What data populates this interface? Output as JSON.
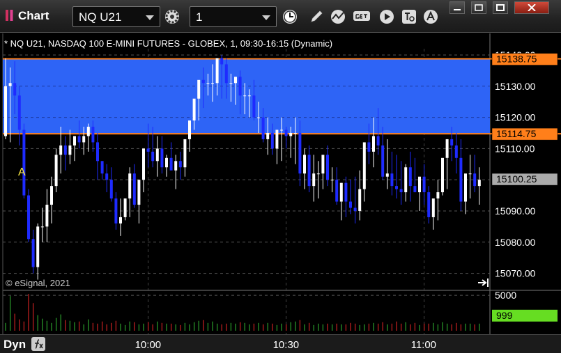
{
  "window": {
    "title": "Chart",
    "symbol": "NQ U21",
    "interval": "1"
  },
  "info": {
    "description": "* NQ U21, NASDAQ 100 E-MINI FUTURES - GLOBEX, 1, 09:30-16:15 (Dynamic)",
    "copyright": "© eSignal, 2021",
    "marker": "A"
  },
  "bottom": {
    "mode": "Dyn"
  },
  "colors": {
    "background": "#000000",
    "zone_fill": "#2e64f6",
    "zone_line": "#ff7f1a",
    "up_bar": "#ffffff",
    "down_bar": "#1e2bff",
    "vol_up": "#2ca02c",
    "vol_down": "#cc2222",
    "current_price_bg": "#aaaaaa",
    "volume_current_bg": "#66dd22"
  },
  "chart_data": {
    "type": "candlestick",
    "price_axis": {
      "ylim": [
        15065,
        15142
      ],
      "ticks": [
        "15140.00",
        "15130.00",
        "15120.00",
        "15110.00",
        "15090.00",
        "15080.00",
        "15070.00"
      ]
    },
    "zone": {
      "top": 15138.75,
      "bottom": 15114.75
    },
    "price_labels": {
      "zone_top": "15138.75",
      "zone_bottom": "15114.75",
      "current": "15100.25"
    },
    "volume_axis": {
      "ylim": [
        0,
        5400
      ],
      "tick": "5000",
      "current": "999"
    },
    "x_ticks": [
      {
        "label": "10:00",
        "index": 31
      },
      {
        "label": "10:30",
        "index": 61
      },
      {
        "label": "11:00",
        "index": 91
      }
    ],
    "bars": {
      "open": [
        15114,
        15130,
        15131,
        15127,
        15116,
        15095,
        15081,
        15072,
        15085,
        15085,
        15092,
        15098,
        15108,
        15111,
        15108,
        15111,
        15114,
        15112,
        15114,
        15117,
        15112,
        15106,
        15102,
        15100,
        15094,
        15086,
        15088,
        15094,
        15102,
        15092,
        15100,
        15110,
        15109,
        15106,
        15110,
        15104,
        15107,
        15103,
        15106,
        15104,
        15113,
        15119,
        15126,
        15132,
        15131,
        15131,
        15131,
        15139,
        15137,
        15131,
        15131,
        15133,
        15127,
        15127,
        15127,
        15120,
        15120,
        15113,
        15115,
        15110,
        15116,
        15116,
        15114,
        15115,
        15115,
        15102,
        15108,
        15098,
        15102,
        15102,
        15108,
        15100,
        15100,
        15093,
        15099,
        15093,
        15091,
        15090,
        15097,
        15112,
        15109,
        15114,
        15111,
        15101,
        15102,
        15098,
        15097,
        15096,
        15104,
        15098,
        15096,
        15101,
        15096,
        15088,
        15094,
        15096,
        15107,
        15113,
        15111,
        15107,
        15093,
        15102,
        15102,
        15098
      ],
      "high": [
        15139,
        15136,
        15138,
        15130,
        15118,
        15097,
        15084,
        15086,
        15091,
        15097,
        15101,
        15110,
        15117,
        15114,
        15116,
        15114,
        15119,
        15117,
        15118,
        15119,
        15115,
        15106,
        15105,
        15104,
        15096,
        15094,
        15094,
        15104,
        15105,
        15096,
        15110,
        15118,
        15117,
        15114,
        15114,
        15108,
        15112,
        15108,
        15109,
        15110,
        15115,
        15123,
        15131,
        15136,
        15134,
        15137,
        15137,
        15140,
        15139,
        15134,
        15133,
        15135,
        15131,
        15129,
        15132,
        15125,
        15123,
        15120,
        15118,
        15114,
        15120,
        15117,
        15117,
        15120,
        15119,
        15110,
        15111,
        15108,
        15106,
        15107,
        15111,
        15104,
        15104,
        15099,
        15101,
        15100,
        15101,
        15103,
        15108,
        15118,
        15120,
        15123,
        15117,
        15113,
        15109,
        15108,
        15106,
        15105,
        15109,
        15107,
        15100,
        15105,
        15098,
        15092,
        15100,
        15102,
        15108,
        15117,
        15115,
        15113,
        15101,
        15108,
        15108,
        15104
      ],
      "low": [
        15113,
        15112,
        15121,
        15111,
        15094,
        15080,
        15070,
        15068,
        15080,
        15080,
        15086,
        15096,
        15102,
        15103,
        15105,
        15106,
        15110,
        15108,
        15109,
        15109,
        15100,
        15100,
        15096,
        15093,
        15084,
        15082,
        15087,
        15088,
        15091,
        15086,
        15096,
        15104,
        15104,
        15101,
        15102,
        15101,
        15104,
        15097,
        15100,
        15101,
        15109,
        15116,
        15119,
        15123,
        15127,
        15125,
        15127,
        15126,
        15126,
        15125,
        15124,
        15121,
        15121,
        15120,
        15119,
        15115,
        15112,
        15108,
        15108,
        15105,
        15106,
        15110,
        15107,
        15105,
        15098,
        15097,
        15096,
        15093,
        15094,
        15097,
        15098,
        15096,
        15092,
        15087,
        15088,
        15089,
        15086,
        15087,
        15093,
        15105,
        15104,
        15108,
        15100,
        15097,
        15095,
        15094,
        15092,
        15093,
        15093,
        15096,
        15090,
        15092,
        15086,
        15084,
        15087,
        15095,
        15097,
        15106,
        15102,
        15090,
        15089,
        15094,
        15096,
        15092
      ],
      "close": [
        15130,
        15131,
        15127,
        15116,
        15095,
        15081,
        15072,
        15085,
        15085,
        15092,
        15098,
        15108,
        15111,
        15108,
        15111,
        15114,
        15112,
        15114,
        15117,
        15112,
        15106,
        15102,
        15100,
        15094,
        15086,
        15088,
        15094,
        15102,
        15092,
        15100,
        15110,
        15109,
        15106,
        15110,
        15104,
        15107,
        15103,
        15106,
        15104,
        15113,
        15119,
        15126,
        15132,
        15131,
        15131,
        15131,
        15139,
        15137,
        15131,
        15131,
        15133,
        15127,
        15127,
        15127,
        15120,
        15120,
        15113,
        15115,
        15110,
        15116,
        15116,
        15114,
        15115,
        15115,
        15102,
        15108,
        15098,
        15102,
        15102,
        15108,
        15100,
        15100,
        15093,
        15099,
        15093,
        15091,
        15090,
        15097,
        15112,
        15109,
        15114,
        15111,
        15101,
        15102,
        15098,
        15097,
        15096,
        15104,
        15098,
        15096,
        15101,
        15096,
        15088,
        15094,
        15096,
        15107,
        15113,
        15111,
        15107,
        15093,
        15102,
        15102,
        15098,
        15100
      ]
    },
    "volume": [
      1100,
      4900,
      2400,
      1600,
      1300,
      5200,
      3900,
      2200,
      1700,
      1400,
      1100,
      1800,
      2300,
      1500,
      1400,
      1200,
      1300,
      900,
      1600,
      1100,
      1000,
      1300,
      900,
      1100,
      1400,
      1000,
      800,
      1300,
      1200,
      900,
      1000,
      1200,
      900,
      1300,
      1100,
      1000,
      1000,
      900,
      800,
      1100,
      900,
      1200,
      1400,
      1500,
      1100,
      1300,
      1000,
      900,
      1000,
      1100,
      1000,
      1200,
      1100,
      900,
      1000,
      1100,
      900,
      1100,
      1000,
      800,
      1000,
      900,
      1200,
      1300,
      1500,
      900,
      1100,
      800,
      1000,
      900,
      1000,
      900,
      1000,
      900,
      900,
      1100,
      1000,
      800,
      900,
      1000,
      1100,
      1000,
      1200,
      900,
      1000,
      1300,
      1000,
      1200,
      900,
      1100,
      800,
      1000,
      1000,
      1100,
      900,
      1200,
      1000,
      900,
      1100,
      900,
      1000,
      1000,
      900,
      1000
    ]
  }
}
